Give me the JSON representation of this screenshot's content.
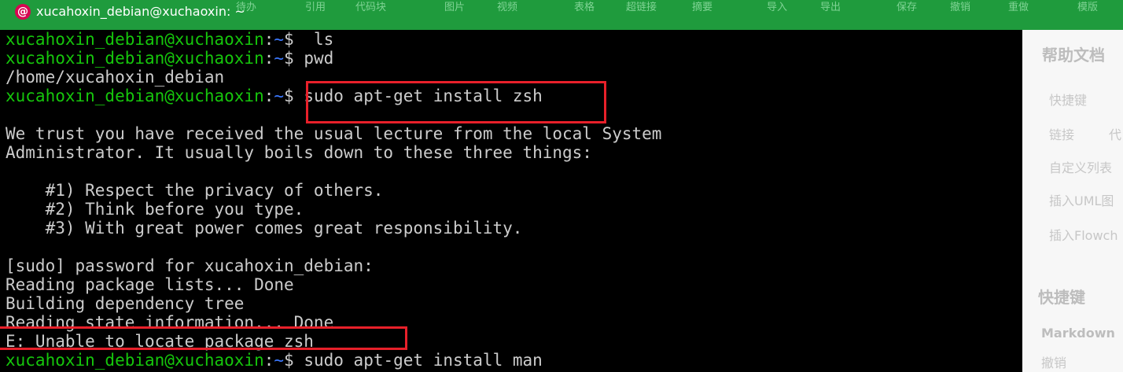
{
  "window": {
    "title": "xucahoxin_debian@xuchaoxin: ~",
    "app_icon": "debian-swirl-icon"
  },
  "background_toolbar": {
    "items": [
      "待办",
      "引用",
      "代码块",
      "图片",
      "视频",
      "表格",
      "超链接",
      "摘要",
      "导入",
      "导出",
      "保存",
      "撤销",
      "重做",
      "模版"
    ]
  },
  "help_pane": {
    "title": "帮助文档",
    "items": [
      "快捷键",
      "链接",
      "代",
      "自定义列表",
      "插入UML图",
      "插入Flowch"
    ],
    "section_title": "快捷键",
    "subsection": "Markdown",
    "sub_item": "撤销"
  },
  "terminal": {
    "prompt": {
      "user_host": "xucahoxin_debian@xuchaoxin",
      "separator": ":",
      "path": "~",
      "symbol": "$"
    },
    "colors": {
      "background": "#000000",
      "text": "#cccccc",
      "user_host": "#16c60c",
      "path": "#3b78ff",
      "annotation": "#e8202a"
    },
    "lines": [
      {
        "cmd": "  ls"
      },
      {
        "cmd": " pwd"
      },
      {
        "text": "/home/xucahoxin_debian"
      },
      {
        "cmd": " sudo apt-get install zsh"
      },
      {
        "text": ""
      },
      {
        "text": "We trust you have received the usual lecture from the local System"
      },
      {
        "text": "Administrator. It usually boils down to these three things:"
      },
      {
        "text": ""
      },
      {
        "text": "    #1) Respect the privacy of others."
      },
      {
        "text": "    #2) Think before you type."
      },
      {
        "text": "    #3) With great power comes great responsibility."
      },
      {
        "text": ""
      },
      {
        "text": "[sudo] password for xucahoxin_debian:"
      },
      {
        "text": "Reading package lists... Done"
      },
      {
        "text": "Building dependency tree"
      },
      {
        "text": "Reading state information... Done"
      },
      {
        "text": "E: Unable to locate package zsh"
      },
      {
        "cmd": " sudo apt-get install man"
      }
    ]
  }
}
